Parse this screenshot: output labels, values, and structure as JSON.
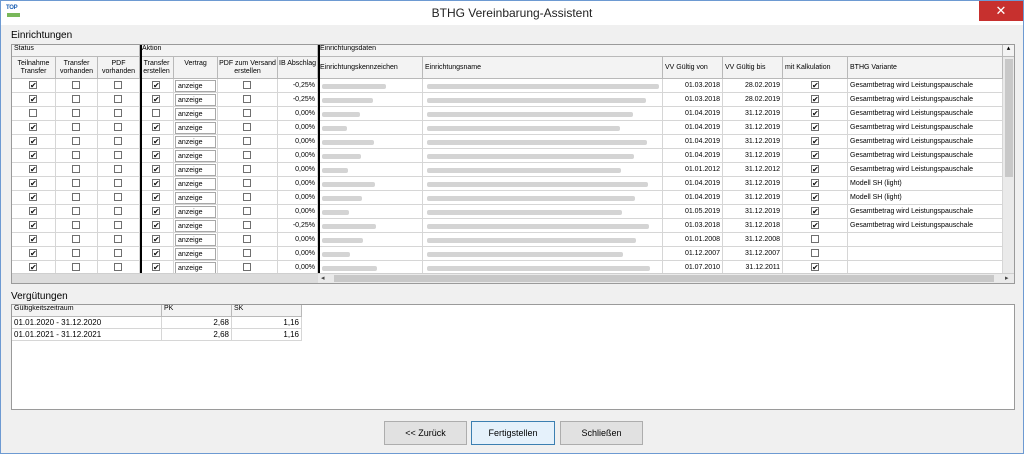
{
  "window": {
    "title": "BTHG Vereinbarung-Assistent",
    "app_icon_text": "TOP",
    "close_glyph": "✕"
  },
  "einrichtungen": {
    "section_label": "Einrichtungen",
    "group_status": "Status",
    "group_aktion": "Aktion",
    "group_daten": "Einrichtungsdaten",
    "columns": {
      "teilnahme_transfer": "Teilnahme Transfer",
      "transfer_vorhanden": "Transfer vorhanden",
      "pdf_vorhanden": "PDF vorhanden",
      "transfer_erstellen": "Transfer erstellen",
      "vertrag": "Vertrag",
      "pdf_versand": "PDF zum Versand erstellen",
      "ib_abschlag": "IB Abschlag",
      "kennzeichen": "Einrichtungskennzeichen",
      "name": "Einrichtungsname",
      "gueltig_von": "VV Gültig von",
      "gueltig_bis": "VV Gültig bis",
      "kalkulation": "mit Kalkulation",
      "variante": "BTHG Variante"
    },
    "rows": [
      {
        "teilnahme": true,
        "transfer": false,
        "pdf": false,
        "erstellen": true,
        "vertrag": "anzeige",
        "pdf_versand": false,
        "ib": "-0,25%",
        "von": "01.03.2018",
        "bis": "28.02.2019",
        "kalk": true,
        "variante": "Gesamtbetrag wird Leistungspauschale"
      },
      {
        "teilnahme": true,
        "transfer": false,
        "pdf": false,
        "erstellen": true,
        "vertrag": "anzeige",
        "pdf_versand": false,
        "ib": "-0,25%",
        "von": "01.03.2018",
        "bis": "28.02.2019",
        "kalk": true,
        "variante": "Gesamtbetrag wird Leistungspauschale"
      },
      {
        "teilnahme": false,
        "transfer": false,
        "pdf": false,
        "erstellen": false,
        "vertrag": "anzeige",
        "pdf_versand": false,
        "ib": "0,00%",
        "von": "01.04.2019",
        "bis": "31.12.2019",
        "kalk": true,
        "variante": "Gesamtbetrag wird Leistungspauschale"
      },
      {
        "teilnahme": true,
        "transfer": false,
        "pdf": false,
        "erstellen": true,
        "vertrag": "anzeige",
        "pdf_versand": false,
        "ib": "0,00%",
        "von": "01.04.2019",
        "bis": "31.12.2019",
        "kalk": true,
        "variante": "Gesamtbetrag wird Leistungspauschale"
      },
      {
        "teilnahme": true,
        "transfer": false,
        "pdf": false,
        "erstellen": true,
        "vertrag": "anzeige",
        "pdf_versand": false,
        "ib": "0,00%",
        "von": "01.04.2019",
        "bis": "31.12.2019",
        "kalk": true,
        "variante": "Gesamtbetrag wird Leistungspauschale"
      },
      {
        "teilnahme": true,
        "transfer": false,
        "pdf": false,
        "erstellen": true,
        "vertrag": "anzeige",
        "pdf_versand": false,
        "ib": "0,00%",
        "von": "01.04.2019",
        "bis": "31.12.2019",
        "kalk": true,
        "variante": "Gesamtbetrag wird Leistungspauschale"
      },
      {
        "teilnahme": true,
        "transfer": false,
        "pdf": false,
        "erstellen": true,
        "vertrag": "anzeige",
        "pdf_versand": false,
        "ib": "0,00%",
        "von": "01.01.2012",
        "bis": "31.12.2012",
        "kalk": true,
        "variante": "Gesamtbetrag wird Leistungspauschale"
      },
      {
        "teilnahme": true,
        "transfer": false,
        "pdf": false,
        "erstellen": true,
        "vertrag": "anzeige",
        "pdf_versand": false,
        "ib": "0,00%",
        "von": "01.04.2019",
        "bis": "31.12.2019",
        "kalk": true,
        "variante": "Modell SH (light)"
      },
      {
        "teilnahme": true,
        "transfer": false,
        "pdf": false,
        "erstellen": true,
        "vertrag": "anzeige",
        "pdf_versand": false,
        "ib": "0,00%",
        "von": "01.04.2019",
        "bis": "31.12.2019",
        "kalk": true,
        "variante": "Modell SH (light)"
      },
      {
        "teilnahme": true,
        "transfer": false,
        "pdf": false,
        "erstellen": true,
        "vertrag": "anzeige",
        "pdf_versand": false,
        "ib": "0,00%",
        "von": "01.05.2019",
        "bis": "31.12.2019",
        "kalk": true,
        "variante": "Gesamtbetrag wird Leistungspauschale"
      },
      {
        "teilnahme": true,
        "transfer": false,
        "pdf": false,
        "erstellen": true,
        "vertrag": "anzeige",
        "pdf_versand": false,
        "ib": "-0,25%",
        "von": "01.03.2018",
        "bis": "31.12.2018",
        "kalk": true,
        "variante": "Gesamtbetrag wird Leistungspauschale"
      },
      {
        "teilnahme": true,
        "transfer": false,
        "pdf": false,
        "erstellen": true,
        "vertrag": "anzeige",
        "pdf_versand": false,
        "ib": "0,00%",
        "von": "01.01.2008",
        "bis": "31.12.2008",
        "kalk": false,
        "variante": ""
      },
      {
        "teilnahme": true,
        "transfer": false,
        "pdf": false,
        "erstellen": true,
        "vertrag": "anzeige",
        "pdf_versand": false,
        "ib": "0,00%",
        "von": "01.12.2007",
        "bis": "31.12.2007",
        "kalk": false,
        "variante": ""
      },
      {
        "teilnahme": true,
        "transfer": false,
        "pdf": false,
        "erstellen": true,
        "vertrag": "anzeige",
        "pdf_versand": false,
        "ib": "0,00%",
        "von": "01.07.2010",
        "bis": "31.12.2011",
        "kalk": true,
        "variante": ""
      }
    ]
  },
  "verguetungen": {
    "section_label": "Vergütungen",
    "columns": {
      "zeitraum": "Gültigkeitszeitraum",
      "pk": "PK",
      "sk": "SK"
    },
    "rows": [
      {
        "zeitraum": "01.01.2020 - 31.12.2020",
        "pk": "2,68",
        "sk": "1,16"
      },
      {
        "zeitraum": "01.01.2021 - 31.12.2021",
        "pk": "2,68",
        "sk": "1,16"
      }
    ]
  },
  "buttons": {
    "zurueck": "<< Zurück",
    "fertigstellen": "Fertigstellen",
    "schliessen": "Schließen"
  },
  "scroll": {
    "left": "◂",
    "right": "▸",
    "up": "▴",
    "down": "▾"
  }
}
